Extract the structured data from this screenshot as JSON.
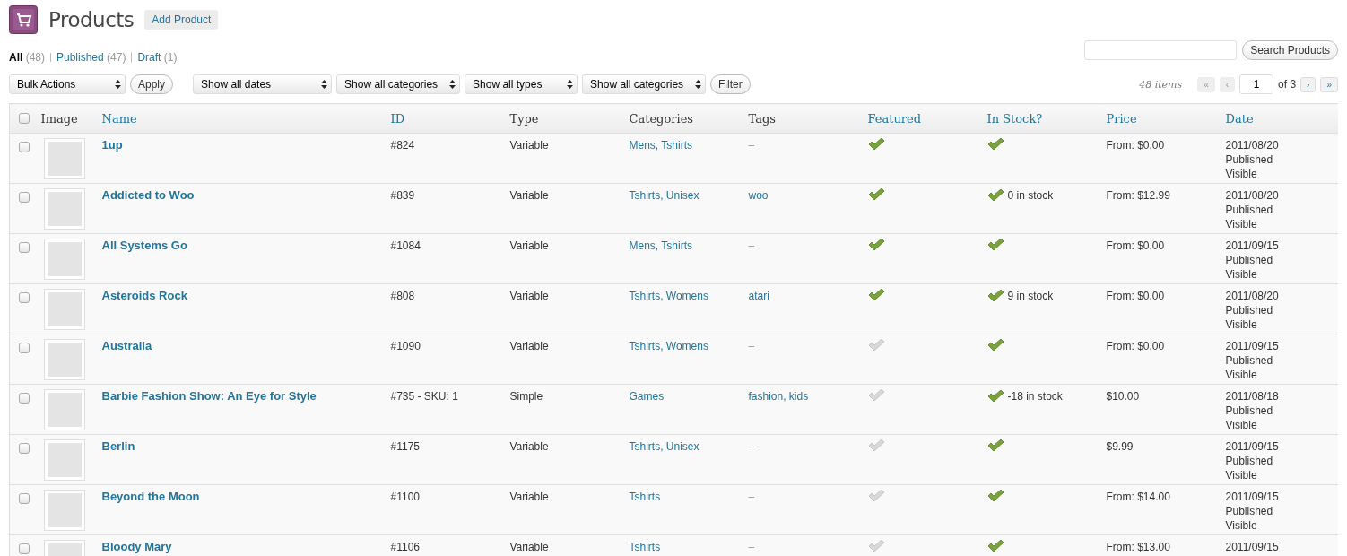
{
  "page": {
    "title": "Products",
    "add_button": "Add Product"
  },
  "views": [
    {
      "label": "All",
      "count": "(48)",
      "selected": true
    },
    {
      "label": "Published",
      "count": "(47)",
      "selected": false
    },
    {
      "label": "Draft",
      "count": "(1)",
      "selected": false
    }
  ],
  "search": {
    "button": "Search Products"
  },
  "bulk": {
    "value": "Bulk Actions",
    "button": "Apply"
  },
  "filters": {
    "selects": [
      "Show all dates",
      "Show all categories",
      "Show all types",
      "Show all categories"
    ],
    "button": "Filter"
  },
  "pagination": {
    "items": "48 items",
    "first": "«",
    "prev": "‹",
    "page": "1",
    "of": "of 3",
    "next": "›",
    "last": "»"
  },
  "table": {
    "select_all_checked": false,
    "columns": [
      {
        "label": "Image",
        "sortable": false
      },
      {
        "label": "Name",
        "sortable": true
      },
      {
        "label": "ID",
        "sortable": true
      },
      {
        "label": "Type",
        "sortable": false
      },
      {
        "label": "Categories",
        "sortable": false
      },
      {
        "label": "Tags",
        "sortable": false
      },
      {
        "label": "Featured",
        "sortable": true
      },
      {
        "label": "In Stock?",
        "sortable": true
      },
      {
        "label": "Price",
        "sortable": true
      },
      {
        "label": "Date",
        "sortable": true
      }
    ],
    "rows": [
      {
        "checked": false,
        "name": "1up",
        "id": "#824",
        "type": "Variable",
        "categories": "Mens, Tshirts",
        "tags": "–",
        "tags_linked": false,
        "featured": true,
        "in_stock": true,
        "price": "From: $0.00",
        "date": "2011/08/20",
        "status": "Published",
        "visibility": "Visible"
      },
      {
        "checked": false,
        "name": "Addicted to Woo",
        "id": "#839",
        "type": "Variable",
        "categories": "Tshirts, Unisex",
        "tags": "woo",
        "tags_linked": true,
        "featured": true,
        "in_stock": true,
        "stock_text": "0 in stock",
        "price": "From: $12.99",
        "date": "2011/08/20",
        "status": "Published",
        "visibility": "Visible"
      },
      {
        "checked": false,
        "name": "All Systems Go",
        "id": "#1084",
        "type": "Variable",
        "categories": "Mens, Tshirts",
        "tags": "–",
        "tags_linked": false,
        "featured": true,
        "in_stock": true,
        "price": "From: $0.00",
        "date": "2011/09/15",
        "status": "Published",
        "visibility": "Visible"
      },
      {
        "checked": false,
        "name": "Asteroids Rock",
        "id": "#808",
        "type": "Variable",
        "categories": "Tshirts, Womens",
        "tags": "atari",
        "tags_linked": true,
        "featured": true,
        "in_stock": true,
        "stock_text": "9 in stock",
        "price": "From: $0.00",
        "date": "2011/08/20",
        "status": "Published",
        "visibility": "Visible"
      },
      {
        "checked": false,
        "name": "Australia",
        "id": "#1090",
        "type": "Variable",
        "categories": "Tshirts, Womens",
        "tags": "–",
        "tags_linked": false,
        "featured": false,
        "in_stock": true,
        "price": "From: $0.00",
        "date": "2011/09/15",
        "status": "Published",
        "visibility": "Visible"
      },
      {
        "checked": false,
        "name": "Barbie Fashion Show: An Eye for Style",
        "id": "#735 - SKU: 1",
        "type": "Simple",
        "categories": "Games",
        "tags": "fashion, kids",
        "tags_linked": true,
        "featured": false,
        "in_stock": true,
        "stock_text": "-18 in stock",
        "price": "$10.00",
        "date": "2011/08/18",
        "status": "Published",
        "visibility": "Visible"
      },
      {
        "checked": false,
        "name": "Berlin",
        "id": "#1175",
        "type": "Variable",
        "categories": "Tshirts, Unisex",
        "tags": "–",
        "tags_linked": false,
        "featured": false,
        "in_stock": true,
        "price": "$9.99",
        "date": "2011/09/15",
        "status": "Published",
        "visibility": "Visible"
      },
      {
        "checked": false,
        "name": "Beyond the Moon",
        "id": "#1100",
        "type": "Variable",
        "categories": "Tshirts",
        "tags": "–",
        "tags_linked": false,
        "featured": false,
        "in_stock": true,
        "price": "From: $14.00",
        "date": "2011/09/15",
        "status": "Published",
        "visibility": "Visible"
      },
      {
        "checked": false,
        "name": "Bloody Mary",
        "id": "#1106",
        "type": "Variable",
        "categories": "Tshirts",
        "tags": "–",
        "tags_linked": false,
        "featured": false,
        "in_stock": true,
        "price": "From: $13.00",
        "date": "2011/09/15"
      }
    ]
  }
}
